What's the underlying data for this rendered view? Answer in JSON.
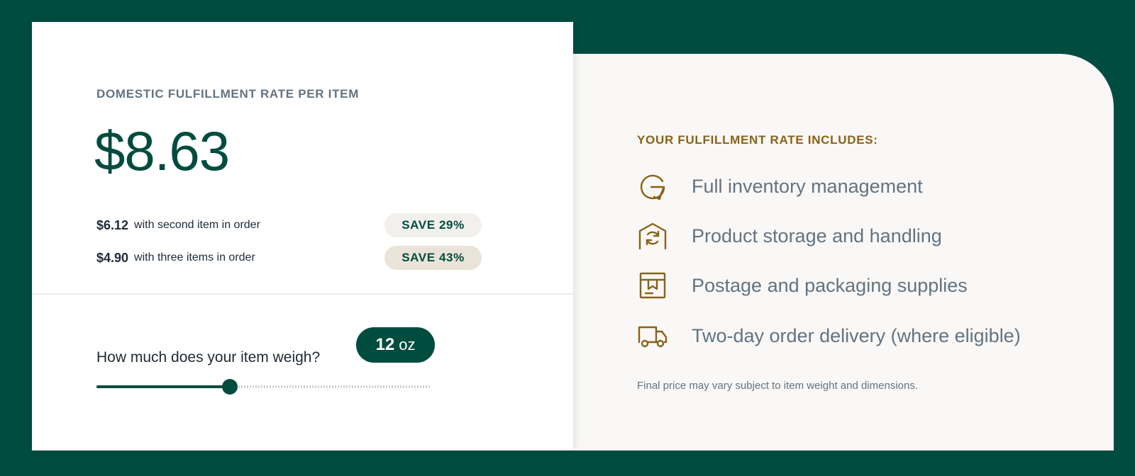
{
  "pricing": {
    "heading": "DOMESTIC FULFILLMENT RATE PER ITEM",
    "price": "$8.63",
    "tiers": [
      {
        "price": "$6.12",
        "description": "with second item in order",
        "badge": "SAVE 29%"
      },
      {
        "price": "$4.90",
        "description": "with three items in order",
        "badge": "SAVE 43%"
      }
    ]
  },
  "weight": {
    "question": "How much does your item weigh?",
    "value": "12",
    "unit": "oz",
    "slider_fraction": 0.4
  },
  "includes": {
    "heading": "YOUR FULFILLMENT RATE INCLUDES:",
    "items": [
      {
        "icon": "inventory-refresh-icon",
        "label": "Full inventory management"
      },
      {
        "icon": "warehouse-icon",
        "label": "Product storage and handling"
      },
      {
        "icon": "package-box-icon",
        "label": "Postage and packaging supplies"
      },
      {
        "icon": "delivery-truck-icon",
        "label": "Two-day order delivery (where eligible)"
      }
    ],
    "fine_print": "Final price may vary subject to item weight and dimensions."
  },
  "colors": {
    "background": "#004c3f",
    "brand_green": "#004c3f",
    "accent_gold": "#8a6116",
    "muted_text": "#637381"
  }
}
